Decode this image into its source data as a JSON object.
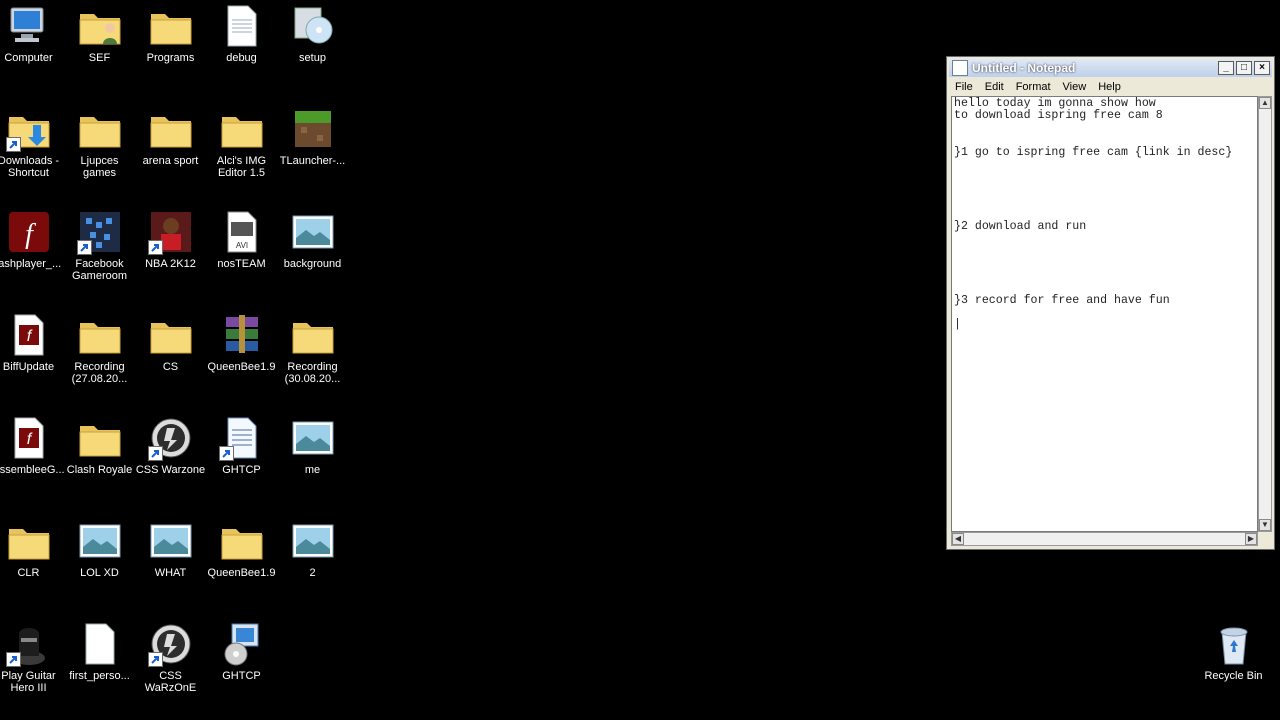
{
  "desktop": {
    "icons": [
      {
        "label": "Computer",
        "icon": "computer-icon"
      },
      {
        "label": "SEF",
        "icon": "user-folder-icon"
      },
      {
        "label": "Programs",
        "icon": "folder-icon"
      },
      {
        "label": "debug",
        "icon": "text-file-icon"
      },
      {
        "label": "setup",
        "icon": "setup-icon"
      },
      {
        "label": "Downloads -\nShortcut",
        "icon": "downloads-shortcut-icon"
      },
      {
        "label": "Ljupces games",
        "icon": "folder-icon"
      },
      {
        "label": "arena sport",
        "icon": "folder-icon"
      },
      {
        "label": "Alci's IMG\nEditor 1.5",
        "icon": "folder-icon"
      },
      {
        "label": "TLauncher-...",
        "icon": "minecraft-icon"
      },
      {
        "label": "lashplayer_...",
        "icon": "flash-icon"
      },
      {
        "label": "Facebook\nGameroom",
        "icon": "gameroom-icon"
      },
      {
        "label": "NBA 2K12",
        "icon": "nba-icon"
      },
      {
        "label": "nosTEAM",
        "icon": "avi-file-icon"
      },
      {
        "label": "background",
        "icon": "image-icon"
      },
      {
        "label": "BiffUpdate",
        "icon": "flash-file-icon"
      },
      {
        "label": "Recording\n(27.08.20...",
        "icon": "folder-icon"
      },
      {
        "label": "CS",
        "icon": "folder-icon"
      },
      {
        "label": "QueenBee1.9",
        "icon": "winrar-icon"
      },
      {
        "label": "Recording\n(30.08.20...",
        "icon": "folder-icon"
      },
      {
        "label": "AssembleeG...",
        "icon": "flash-file-icon"
      },
      {
        "label": "Clash Royale",
        "icon": "folder-icon"
      },
      {
        "label": "CSS Warzone",
        "icon": "css-icon"
      },
      {
        "label": "GHTCP",
        "icon": "document-icon"
      },
      {
        "label": "me",
        "icon": "image-icon"
      },
      {
        "label": "CLR",
        "icon": "folder-icon"
      },
      {
        "label": "LOL XD",
        "icon": "image-icon"
      },
      {
        "label": "WHAT",
        "icon": "image-icon"
      },
      {
        "label": "QueenBee1.9",
        "icon": "folder-icon"
      },
      {
        "label": "2",
        "icon": "image-icon"
      },
      {
        "label": "Play Guitar\nHero III",
        "icon": "guitar-hero-icon"
      },
      {
        "label": "first_perso...",
        "icon": "blank-file-icon"
      },
      {
        "label": "CSS WaRzOnE",
        "icon": "css-icon"
      },
      {
        "label": "GHTCP",
        "icon": "installer-icon"
      }
    ],
    "recycle_bin": {
      "label": "Recycle Bin",
      "icon": "recycle-bin-icon"
    }
  },
  "notepad": {
    "title": "Untitled - Notepad",
    "menu": [
      "File",
      "Edit",
      "Format",
      "View",
      "Help"
    ],
    "text": "hello today im gonna show how\nto download ispring free cam 8\n\n\n}1 go to ispring free cam {link in desc}\n\n\n\n\n\n}2 download and run\n\n\n\n\n\n}3 record for free and have fun\n\n|"
  }
}
